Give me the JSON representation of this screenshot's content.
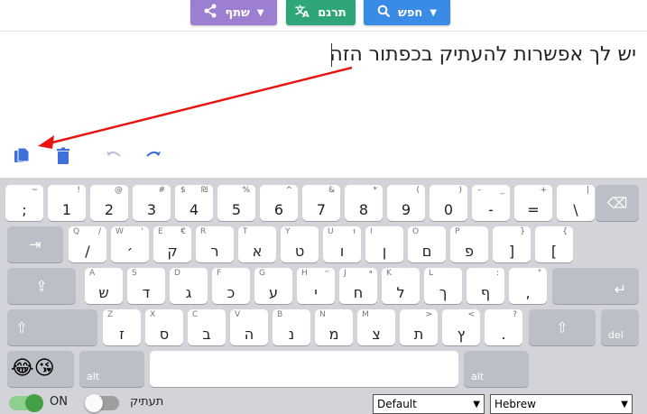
{
  "toolbar": {
    "share_label": "שתף",
    "translate_label": "תרגם",
    "search_label": "חפש"
  },
  "editor": {
    "text": "יש לך אפשרות להעתיק בכפתור הזה"
  },
  "keyboard": {
    "row1": [
      {
        "top": "~",
        "main": ";"
      },
      {
        "top": "!",
        "main": "1"
      },
      {
        "top": "@",
        "main": "2"
      },
      {
        "top": "#",
        "main": "3"
      },
      {
        "top": "₪",
        "top2": "$",
        "main": "4"
      },
      {
        "top": "%",
        "main": "5"
      },
      {
        "top": "^",
        "main": "6"
      },
      {
        "top": "&",
        "main": "7"
      },
      {
        "top": "*",
        "main": "8"
      },
      {
        "top": "(",
        "main": "9"
      },
      {
        "top": ")",
        "main": "0"
      },
      {
        "top": "_",
        "top2": "–",
        "main": "-"
      },
      {
        "top": "+",
        "main": "="
      },
      {
        "top": "|",
        "main": "\\"
      }
    ],
    "row2": [
      {
        "sub": "Q",
        "top": "/",
        "main": "/"
      },
      {
        "sub": "W",
        "top": "'",
        "main": "׳"
      },
      {
        "sub": "E",
        "top": "€",
        "main": "ק"
      },
      {
        "sub": "R",
        "main": "ר"
      },
      {
        "sub": "T",
        "main": "א"
      },
      {
        "sub": "Y",
        "main": "ט"
      },
      {
        "sub": "U",
        "top": "וּ",
        "main": "ו"
      },
      {
        "sub": "I",
        "main": "ן"
      },
      {
        "sub": "O",
        "main": "ם"
      },
      {
        "sub": "P",
        "main": "פ"
      },
      {
        "top": "}",
        "main": "]"
      },
      {
        "top": "{",
        "main": "["
      }
    ],
    "row3": [
      {
        "sub": "A",
        "main": "ש"
      },
      {
        "sub": "S",
        "main": "ד"
      },
      {
        "sub": "D",
        "main": "ג"
      },
      {
        "sub": "F",
        "main": "כ"
      },
      {
        "sub": "G",
        "main": "ע"
      },
      {
        "sub": "H",
        "top": "״",
        "main": "י"
      },
      {
        "sub": "J",
        "top": "ײ",
        "main": "ח"
      },
      {
        "sub": "K",
        "main": "ל"
      },
      {
        "sub": "L",
        "main": "ך"
      },
      {
        "top": ":",
        "main": "ף"
      },
      {
        "top": "\"",
        "main": ","
      }
    ],
    "row4": [
      {
        "sub": "Z",
        "main": "ז"
      },
      {
        "sub": "X",
        "main": "ס"
      },
      {
        "sub": "C",
        "main": "ב"
      },
      {
        "sub": "V",
        "main": "ה"
      },
      {
        "sub": "B",
        "main": "נ"
      },
      {
        "sub": "N",
        "main": "מ"
      },
      {
        "sub": "M",
        "main": "צ"
      },
      {
        "top": ">",
        "main": "ת"
      },
      {
        "top": "<",
        "main": "ץ"
      },
      {
        "top": "?",
        "main": "."
      }
    ],
    "alt_label": "alt",
    "del_label": "del",
    "emoji": "😂😘"
  },
  "controls": {
    "on_label": "ON",
    "copy_label": "תעתיק",
    "layout_select": "Default",
    "language_select": "Hebrew"
  }
}
